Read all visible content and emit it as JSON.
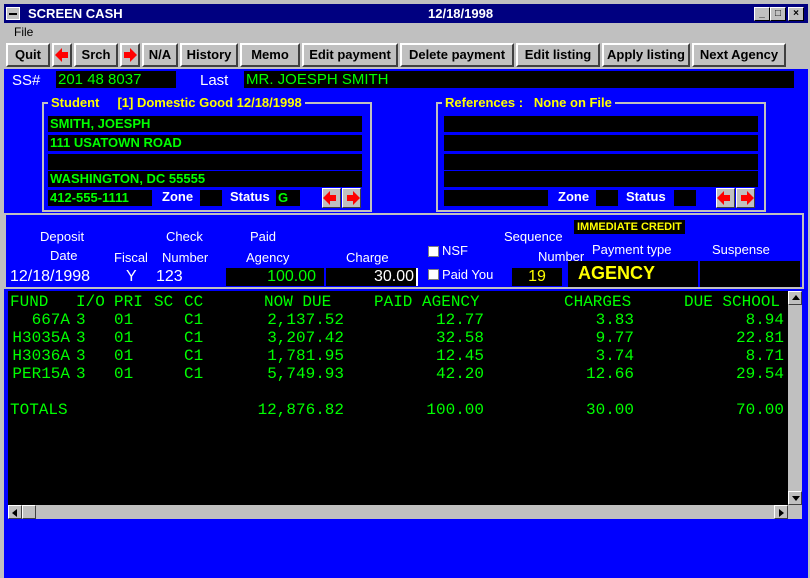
{
  "window": {
    "title": "SCREEN CASH",
    "date": "12/18/1998"
  },
  "menu": {
    "file": "File"
  },
  "toolbar": {
    "quit": "Quit",
    "srch": "Srch",
    "na": "N/A",
    "history": "History",
    "memo": "Memo",
    "edit_payment": "Edit payment",
    "delete_payment": "Delete payment",
    "edit_listing": "Edit listing",
    "apply_listing": "Apply listing",
    "next_agency": "Next Agency"
  },
  "header": {
    "ss_label": "SS#",
    "ss_value": "201 48 8037",
    "last_label": "Last",
    "name_value": "MR.  JOESPH      SMITH"
  },
  "student": {
    "title": "Student",
    "info": "[1] Domestic Good  12/18/1998",
    "lines": [
      "SMITH, JOESPH",
      "111 USATOWN ROAD",
      "",
      "WASHINGTON, DC 55555"
    ],
    "phone": "412-555-1111",
    "zone_label": "Zone",
    "zone_value": "",
    "status_label": "Status",
    "status_value": "G"
  },
  "references": {
    "title": "References :",
    "value": "None on File",
    "zone_label": "Zone",
    "status_label": "Status"
  },
  "payment": {
    "deposit_label": "Deposit",
    "date_label": "Date",
    "check_label": "Check",
    "fiscal_label": "Fiscal",
    "number_label": "Number",
    "paid_label": "Paid",
    "agency_label": "Agency",
    "charge_label": "Charge",
    "nsf_label": "NSF",
    "paid_you_label": "Paid You",
    "sequence_label": "Sequence",
    "seq_number_label": "Number",
    "immediate_credit": "IMMEDIATE CREDIT",
    "payment_type_label": "Payment type",
    "suspense_label": "Suspense",
    "deposit_date": "12/18/1998",
    "fiscal": "Y",
    "check_number": "123",
    "paid_agency": "100.00",
    "charge": "30.00",
    "sequence_number": "19",
    "payment_type": "AGENCY"
  },
  "grid": {
    "headers": {
      "fund": "FUND",
      "io": "I/O",
      "pri": "PRI",
      "sc": "SC",
      "cc": "CC",
      "now_due": "NOW DUE",
      "paid_agency": "PAID AGENCY",
      "charges": "CHARGES",
      "due_school": "DUE SCHOOL"
    },
    "rows": [
      {
        "fund": " 667A",
        "io": "3",
        "pri": "01",
        "cc": "C1",
        "now_due": "2,137.52",
        "paid": "12.77",
        "charges": "3.83",
        "due": "8.94"
      },
      {
        "fund": "H3035A",
        "io": "3",
        "pri": "01",
        "cc": "C1",
        "now_due": "3,207.42",
        "paid": "32.58",
        "charges": "9.77",
        "due": "22.81"
      },
      {
        "fund": "H3036A",
        "io": "3",
        "pri": "01",
        "cc": "C1",
        "now_due": "1,781.95",
        "paid": "12.45",
        "charges": "3.74",
        "due": "8.71"
      },
      {
        "fund": "PER15A",
        "io": "3",
        "pri": "01",
        "cc": "C1",
        "now_due": "5,749.93",
        "paid": "42.20",
        "charges": "12.66",
        "due": "29.54"
      }
    ],
    "totals": {
      "label": "TOTALS",
      "now_due": "12,876.82",
      "paid": "100.00",
      "charges": "30.00",
      "due": "70.00"
    }
  }
}
